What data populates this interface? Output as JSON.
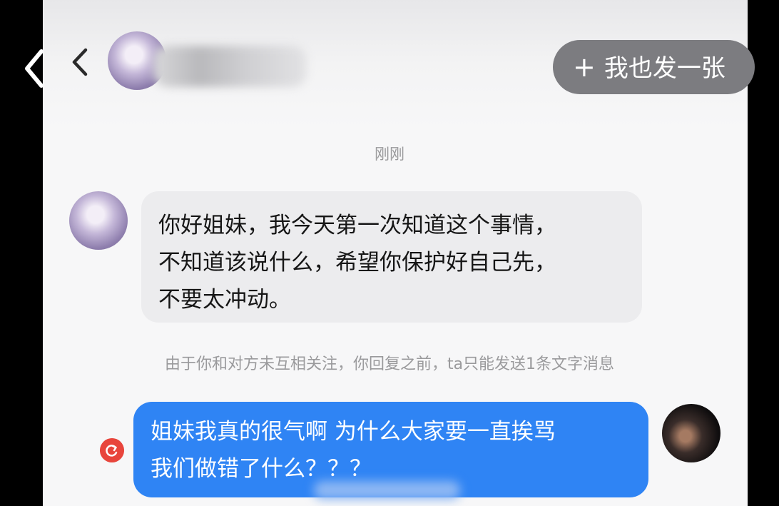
{
  "header": {
    "back_icon": "chevron-left-icon",
    "share_button": {
      "icon": "plus-icon",
      "label": "我也发一张"
    }
  },
  "chat": {
    "timestamp": "刚刚",
    "peer_message": {
      "lines": [
        "你好姐妹，我今天第一次知道这个事情，",
        "不知道该说什么，希望你保护好自己先，",
        "不要太冲动。"
      ]
    },
    "notice": "由于你和对方未互相关注，你回复之前，ta只能发送1条文字消息",
    "my_message": {
      "lines": [
        "姐妹我真的很气啊 为什么大家要一直挨骂",
        "我们做错了什么？？？"
      ],
      "status_icon": "resend-icon"
    }
  },
  "colors": {
    "my_bubble": "#2f84f4",
    "peer_bubble": "#ececee",
    "share_button": "#7c7c80",
    "resend": "#e8453c"
  }
}
